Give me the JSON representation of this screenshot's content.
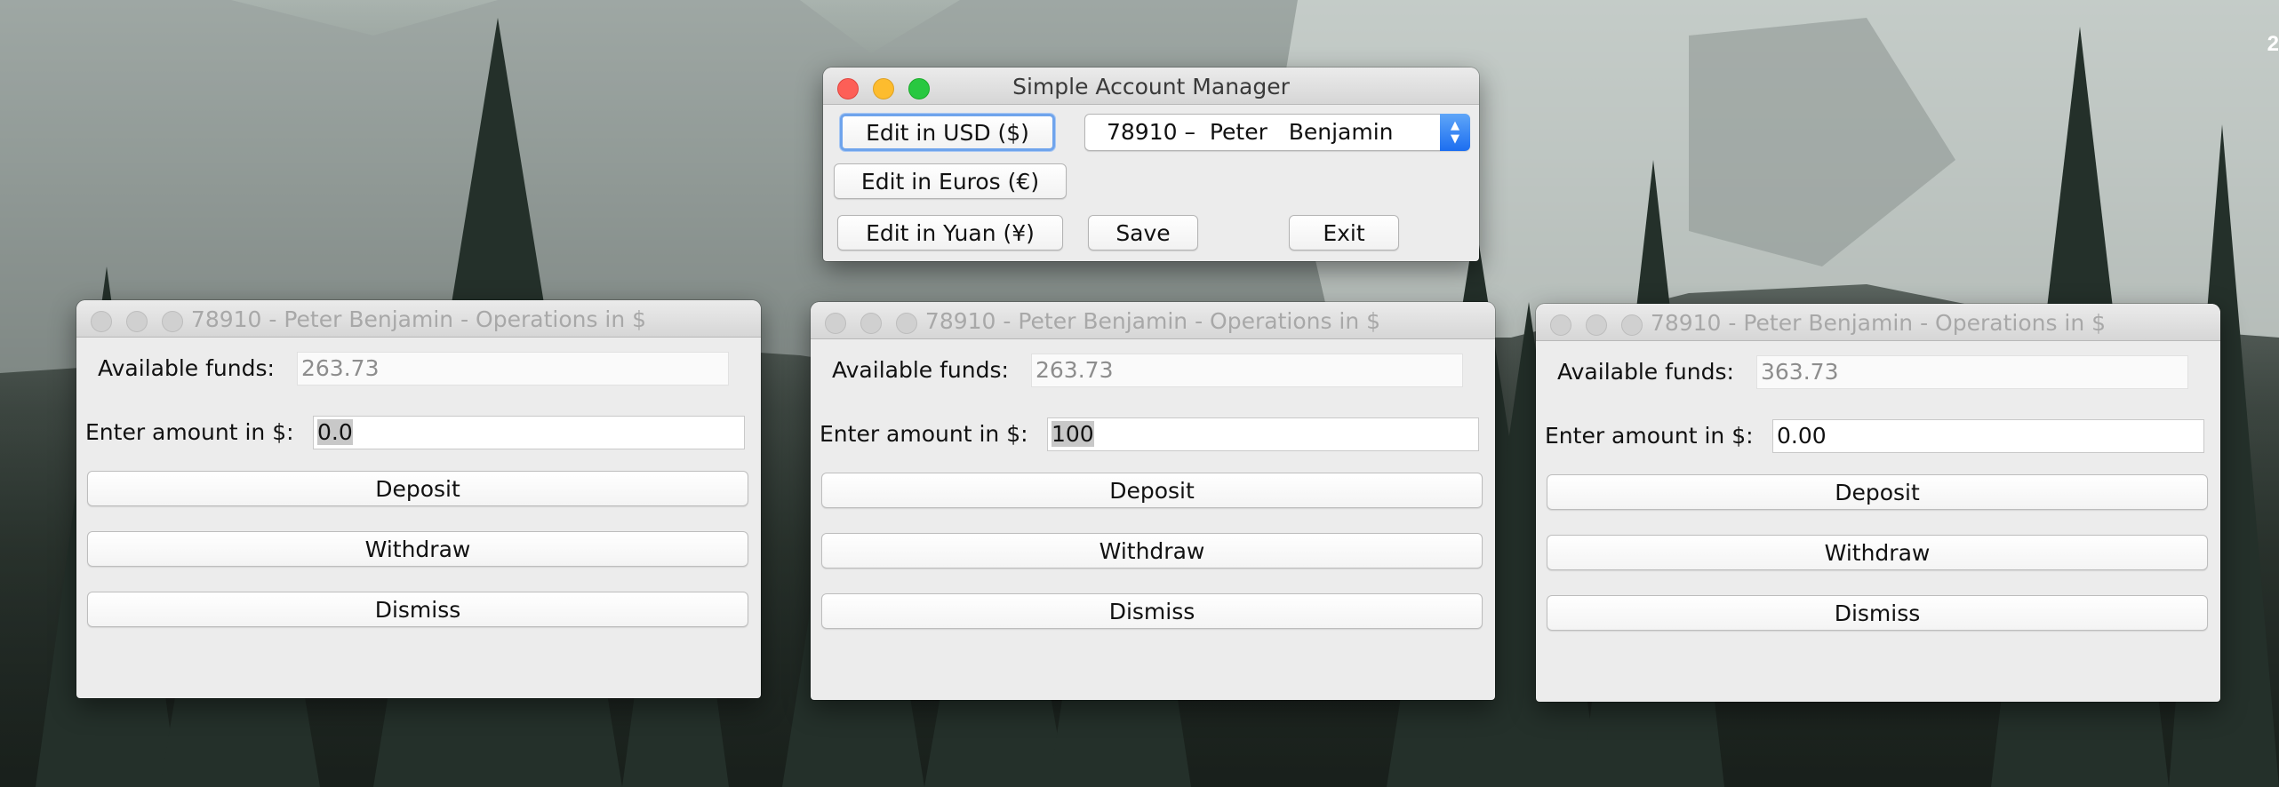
{
  "desktop": {
    "clock_fragment": "2"
  },
  "main_window": {
    "title": "Simple Account Manager",
    "buttons": {
      "edit_usd": "Edit in USD ($)",
      "edit_euros": "Edit in Euros (€)",
      "edit_yuan": "Edit in Yuan (¥)",
      "save": "Save",
      "exit": "Exit"
    },
    "account_select": {
      "selected": "78910 –  Peter   Benjamin"
    }
  },
  "operation_windows": [
    {
      "title": "78910 -  Peter   Benjamin - Operations in $",
      "available_label": "Available funds:",
      "available_value": "263.73",
      "amount_label": "Enter amount in $:",
      "amount_value": "0.0",
      "deposit": "Deposit",
      "withdraw": "Withdraw",
      "dismiss": "Dismiss"
    },
    {
      "title": "78910 -  Peter   Benjamin - Operations in $",
      "available_label": "Available funds:",
      "available_value": "263.73",
      "amount_label": "Enter amount in $:",
      "amount_value": "100",
      "deposit": "Deposit",
      "withdraw": "Withdraw",
      "dismiss": "Dismiss"
    },
    {
      "title": "78910 -  Peter   Benjamin - Operations in $",
      "available_label": "Available funds:",
      "available_value": "363.73",
      "amount_label": "Enter amount in $:",
      "amount_value": "0.00",
      "deposit": "Deposit",
      "withdraw": "Withdraw",
      "dismiss": "Dismiss"
    }
  ]
}
